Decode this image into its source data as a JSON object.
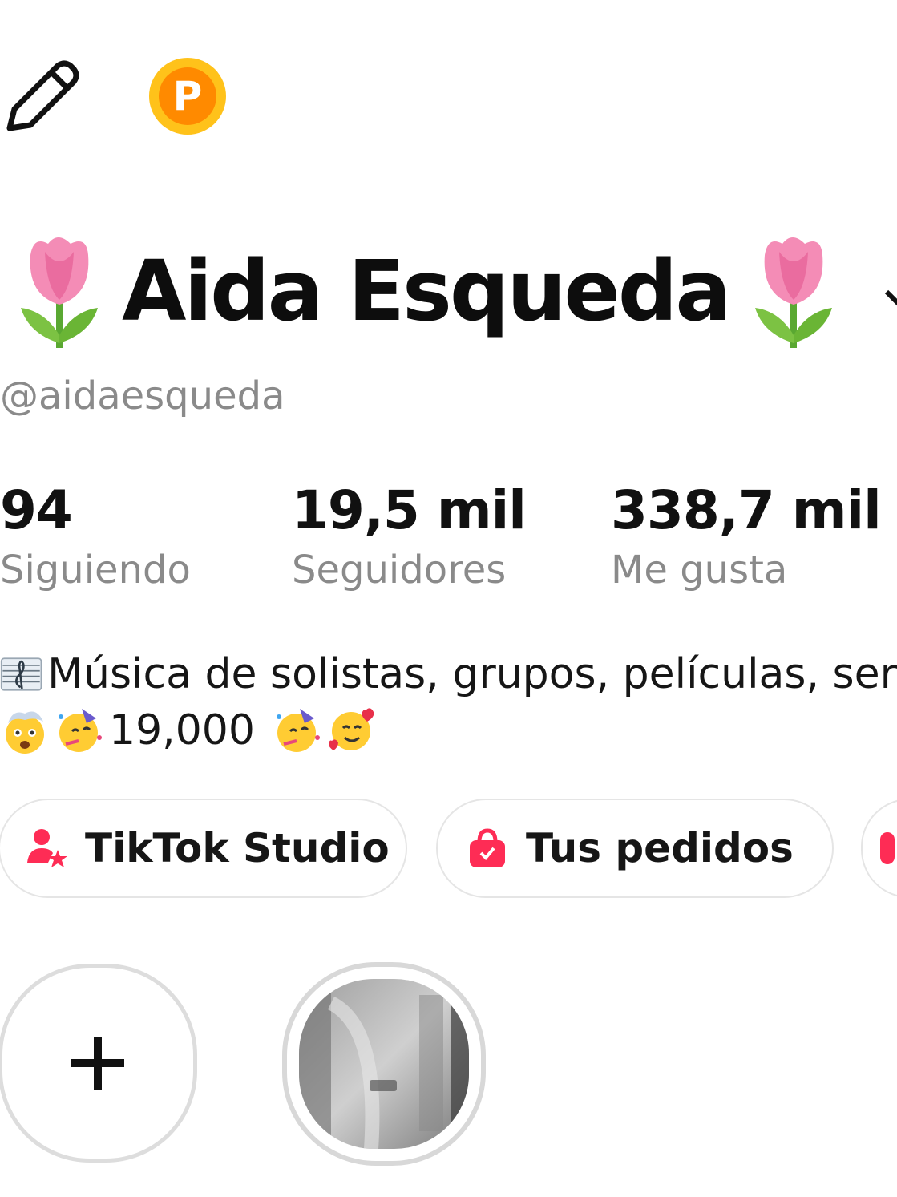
{
  "toolbar": {
    "edit_icon": "pencil-icon",
    "points_badge_label": "P",
    "points_badge_color": "#ff8a00"
  },
  "profile": {
    "display_name": "Aida Esqueda",
    "name_emoji": "tulip",
    "username": "@aidaesqueda"
  },
  "stats": [
    {
      "value": "94",
      "label": "Siguiendo"
    },
    {
      "value": "19,5 mil",
      "label": "Seguidores"
    },
    {
      "value": "338,7 mil",
      "label": "Me gusta"
    }
  ],
  "bio": {
    "line1": "Música de solistas, grupos, películas, ser",
    "line2": "19,000"
  },
  "shortcuts": [
    {
      "label": "TikTok Studio",
      "icon": "creator-star-icon"
    },
    {
      "label": "Tus pedidos",
      "icon": "shopping-bag-icon"
    }
  ],
  "colors": {
    "accent_pink": "#fe2c55",
    "muted_text": "#8a8a8a",
    "border": "#e5e5e5"
  }
}
